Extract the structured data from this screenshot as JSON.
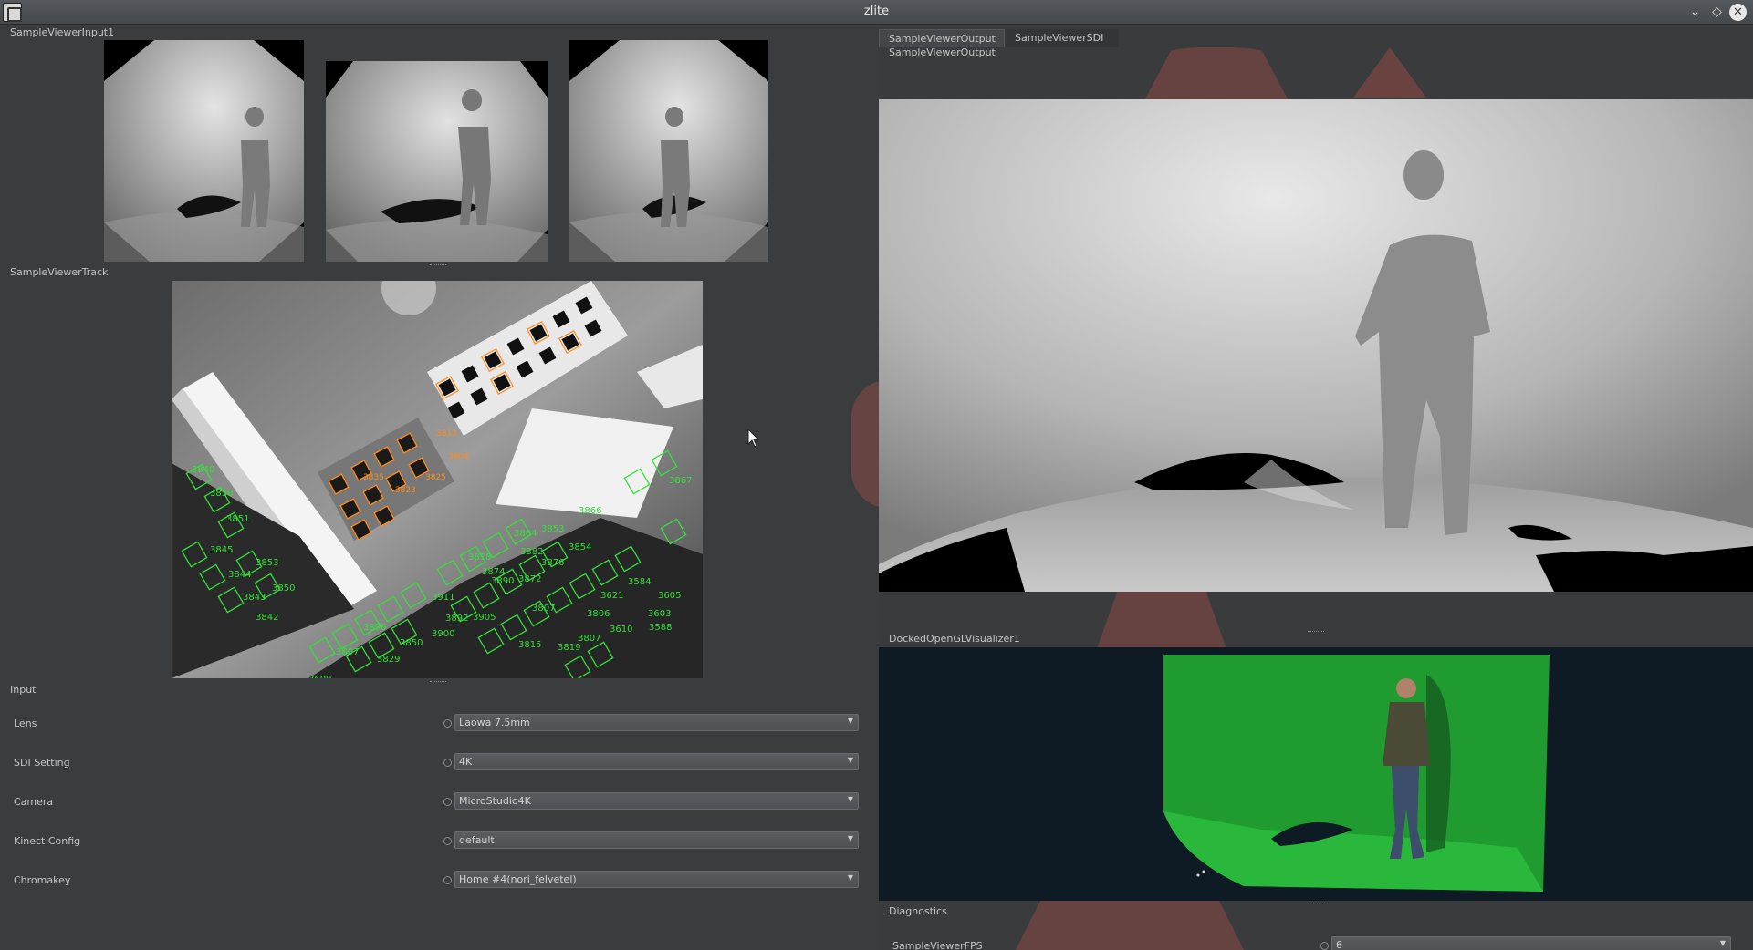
{
  "window": {
    "title": "zlite"
  },
  "left": {
    "input_viewer_label": "SampleViewerInput1",
    "track_viewer_label": "SampleViewerTrack",
    "input_section_label": "Input",
    "fields": [
      {
        "label": "Lens",
        "value": "Laowa 7.5mm"
      },
      {
        "label": "SDI Setting",
        "value": "4K"
      },
      {
        "label": "Camera",
        "value": "MicroStudio4K"
      },
      {
        "label": "Kinect Config",
        "value": "default"
      },
      {
        "label": "Chromakey",
        "value": "Home #4(nori_felvetel)"
      }
    ]
  },
  "right": {
    "tabs": [
      {
        "label": "SampleViewerOutput"
      },
      {
        "label": "SampleViewerSDI"
      }
    ],
    "output_label": "SampleViewerOutput",
    "gl_label": "DockedOpenGLVisualizer1",
    "diagnostics_label": "Diagnostics",
    "diagnostics_field": {
      "label": "SampleViewerFPS",
      "value": "6"
    }
  },
  "tracking": {
    "orange_labels": [
      "3813",
      "3804",
      "3835",
      "3823",
      "3825"
    ],
    "green_labels": [
      "3840",
      "3830",
      "3851",
      "3845",
      "3844",
      "3843",
      "3842",
      "3853",
      "3850",
      "3872",
      "3876",
      "3882",
      "3854",
      "3911",
      "3892",
      "3905",
      "3807",
      "3609",
      "3610",
      "3588",
      "3605",
      "3584",
      "3866",
      "3896",
      "3900",
      "3815",
      "3819",
      "3829",
      "3807",
      "3621",
      "3864",
      "3853",
      "3874",
      "3807",
      "3806",
      "3850",
      "3603",
      "3878",
      "3890",
      "3867"
    ]
  },
  "colors": {
    "window_bg": "#3a3b3d",
    "marker_orange": "#ff8c1a",
    "marker_green": "#34e03a",
    "chroma_green": "#1f9b2f"
  }
}
